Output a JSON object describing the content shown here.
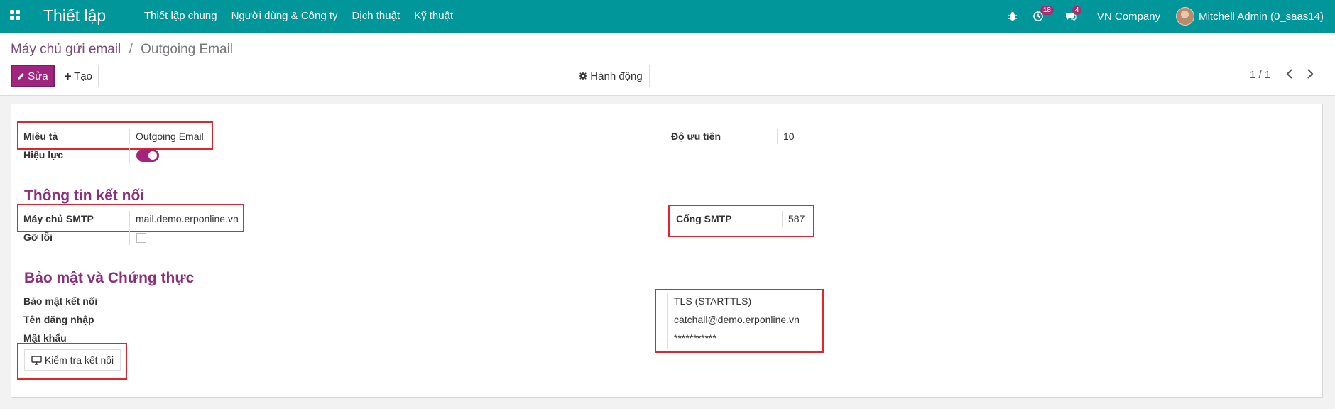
{
  "navbar": {
    "brand": "Thiết lập",
    "menu": [
      "Thiết lập chung",
      "Người dùng & Công ty",
      "Dịch thuật",
      "Kỹ thuật"
    ],
    "activity_count": "18",
    "message_count": "4",
    "company": "VN Company",
    "user": "Mitchell Admin (0_saas14)"
  },
  "breadcrumb": {
    "parent": "Máy chủ gửi email",
    "separator": "/",
    "current": "Outgoing Email"
  },
  "toolbar": {
    "edit_label": "Sửa",
    "create_label": "Tạo",
    "action_label": "Hành động",
    "pager": "1 / 1"
  },
  "form": {
    "description_label": "Miêu tả",
    "description_value": "Outgoing Email",
    "active_label": "Hiệu lực",
    "active": true,
    "priority_label": "Độ ưu tiên",
    "priority_value": "10",
    "connection_section": "Thông tin kết nối",
    "smtp_server_label": "Máy chủ SMTP",
    "smtp_server_value": "mail.demo.erponline.vn",
    "debug_label": "Gỡ lỗi",
    "debug": false,
    "smtp_port_label": "Cổng SMTP",
    "smtp_port_value": "587",
    "security_section": "Bảo mật và Chứng thực",
    "encryption_label": "Bảo mật kết nối",
    "encryption_value": "TLS (STARTTLS)",
    "username_label": "Tên đăng nhập",
    "username_value": "catchall@demo.erponline.vn",
    "password_label": "Mật khẩu",
    "password_value": "***********",
    "test_button_label": "Kiểm tra kết nối"
  },
  "colors": {
    "navbar": "#00969a",
    "primary": "#a1257e",
    "section_title": "#8b2e7b",
    "highlight": "#e0252e"
  }
}
